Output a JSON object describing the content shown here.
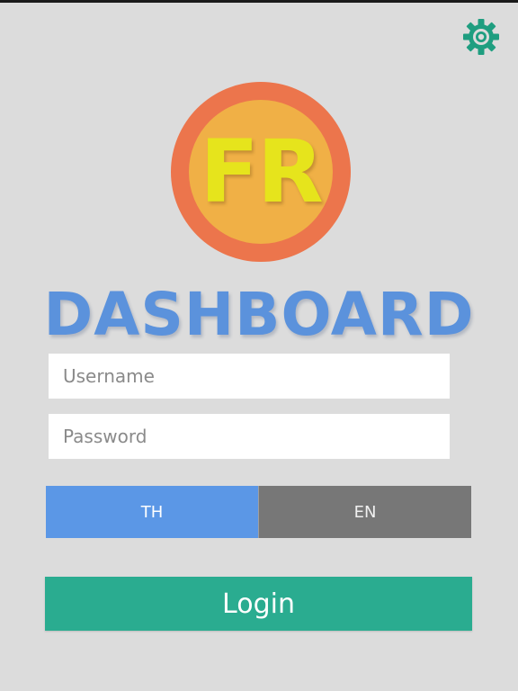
{
  "header": {
    "settings_icon": "gear-icon"
  },
  "logo": {
    "text": "FR",
    "outer_color": "#ec754c",
    "inner_color": "#f0b046",
    "text_color": "#e6e41c"
  },
  "app": {
    "title": "DASHBOARD",
    "title_color": "#5b92dc"
  },
  "form": {
    "username": {
      "placeholder": "Username",
      "value": ""
    },
    "password": {
      "placeholder": "Password",
      "value": ""
    }
  },
  "language": {
    "options": [
      "TH",
      "EN"
    ],
    "th_label": "TH",
    "en_label": "EN",
    "selected": "TH",
    "selected_color": "#5b97e6",
    "unselected_color": "#777777"
  },
  "login": {
    "label": "Login",
    "color": "#2aac90"
  }
}
